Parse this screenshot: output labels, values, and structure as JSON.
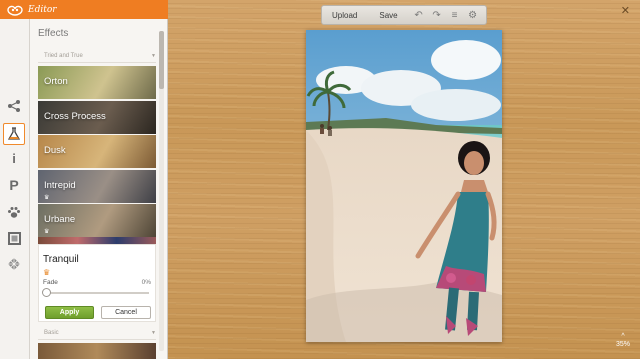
{
  "app": {
    "title": "Editor"
  },
  "toolbar": {
    "upload_label": "Upload",
    "save_label": "Save"
  },
  "panel": {
    "title": "Effects",
    "category_selected": "Tried and True",
    "effects": [
      {
        "label": "Orton",
        "premium": false,
        "colors": [
          "#8a9a55",
          "#cfc38f",
          "#6e6a4a"
        ]
      },
      {
        "label": "Cross Process",
        "premium": false,
        "colors": [
          "#3a3a36",
          "#6b5d4f",
          "#2b2620"
        ]
      },
      {
        "label": "Dusk",
        "premium": false,
        "colors": [
          "#b7874a",
          "#d7b57a",
          "#7c5a34"
        ]
      },
      {
        "label": "Intrepid",
        "premium": true,
        "colors": [
          "#5f6470",
          "#9a8f86",
          "#3e3f46"
        ]
      },
      {
        "label": "Urbane",
        "premium": true,
        "colors": [
          "#6d6f63",
          "#b09b80",
          "#4e4536"
        ]
      }
    ],
    "selected_effect": {
      "name": "Tranquil",
      "premium": true,
      "fade_label": "Fade",
      "fade_value": "0%",
      "fade_fraction": 0,
      "apply_label": "Apply",
      "cancel_label": "Cancel"
    },
    "basic_category": "Basic"
  },
  "canvas": {
    "zoom": "35%"
  },
  "rail": [
    {
      "icon": "share-icon"
    },
    {
      "icon": "flask-icon",
      "active": true
    },
    {
      "icon": "info-icon"
    },
    {
      "icon": "text-p-icon"
    },
    {
      "icon": "paw-icon"
    },
    {
      "icon": "frame-icon"
    },
    {
      "icon": "texture-icon"
    }
  ],
  "colors": {
    "header": "#ef7d22",
    "apply": "#7aac33",
    "active_outline": "#f08a2c"
  }
}
